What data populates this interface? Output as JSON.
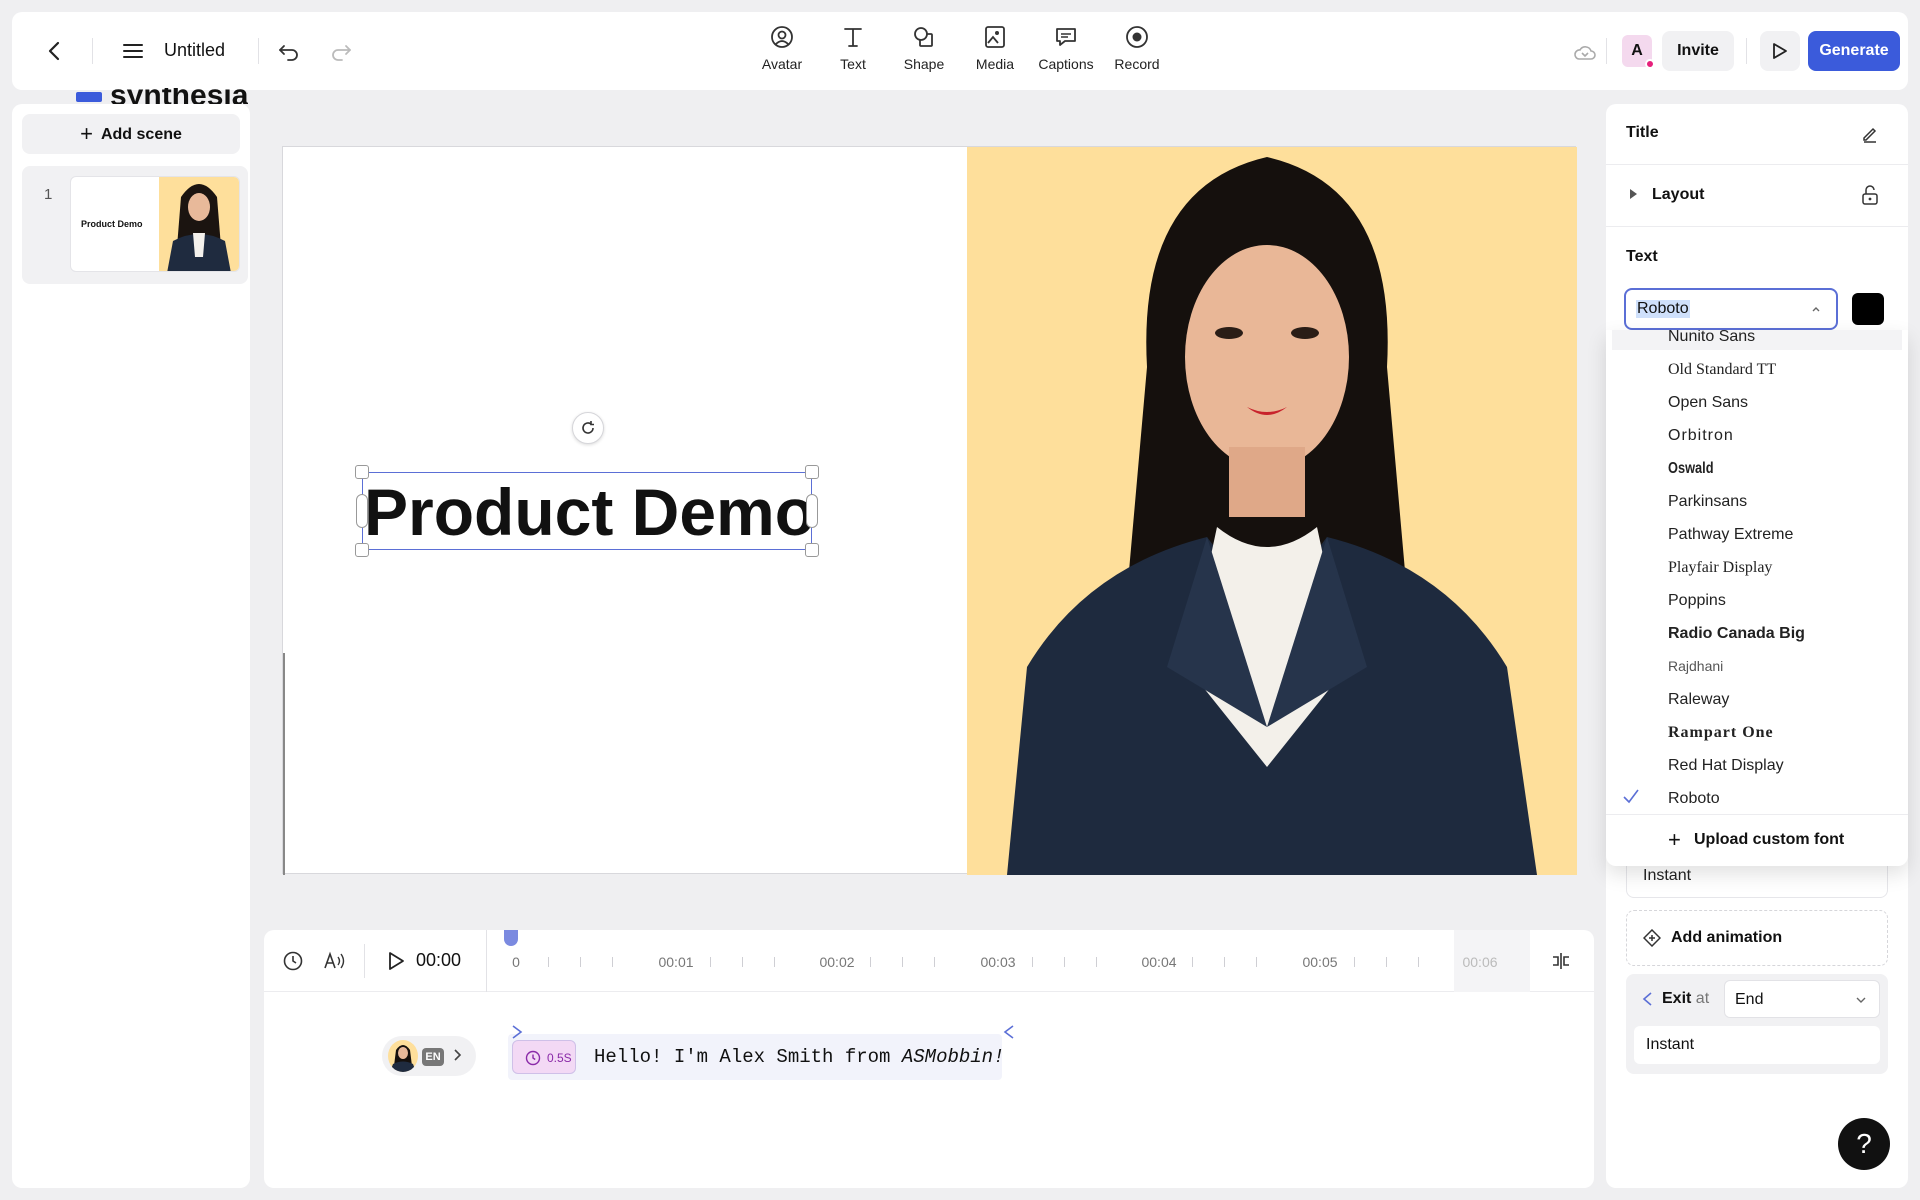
{
  "topbar": {
    "title": "Untitled",
    "tools": [
      {
        "label": "Avatar",
        "icon": "avatar-icon"
      },
      {
        "label": "Text",
        "icon": "text-icon"
      },
      {
        "label": "Shape",
        "icon": "shape-icon"
      },
      {
        "label": "Media",
        "icon": "media-icon"
      },
      {
        "label": "Captions",
        "icon": "captions-icon"
      },
      {
        "label": "Record",
        "icon": "record-icon"
      }
    ],
    "user_initial": "A",
    "invite_label": "Invite",
    "generate_label": "Generate",
    "accent_color": "#3b5bdb"
  },
  "brand_peek": "synthesia",
  "scenes": {
    "add_label": "Add scene",
    "items": [
      {
        "number": "1",
        "thumb_title": "Product Demo"
      }
    ]
  },
  "canvas": {
    "headline": "Product Demo",
    "background_color": "#fedf9b"
  },
  "timeline": {
    "current_time": "00:00",
    "ticks": [
      "0",
      "00:01",
      "00:02",
      "00:03",
      "00:04",
      "00:05",
      "00:06"
    ],
    "language_badge": "EN",
    "pause_label": "0.5S",
    "script_text": "Hello! I'm Alex Smith from ",
    "script_emphasis": "ASMobbin!"
  },
  "panel": {
    "title_label": "Title",
    "layout_label": "Layout",
    "text_label": "Text",
    "font_value": "Roboto",
    "text_color": "#000000",
    "font_options": [
      "Nunito Sans",
      "Old Standard TT",
      "Open Sans",
      "Orbitron",
      "Oswald",
      "Parkinsans",
      "Pathway Extreme",
      "Playfair Display",
      "Poppins",
      "Radio Canada Big",
      "Rajdhani",
      "Raleway",
      "Rampart One",
      "Red Hat Display",
      "Roboto"
    ],
    "selected_font": "Roboto",
    "upload_label": "Upload custom font",
    "entry_value": "Instant",
    "add_animation_label": "Add animation",
    "exit_label": "Exit",
    "exit_at": "at",
    "exit_value": "End",
    "exit_instant": "Instant"
  }
}
